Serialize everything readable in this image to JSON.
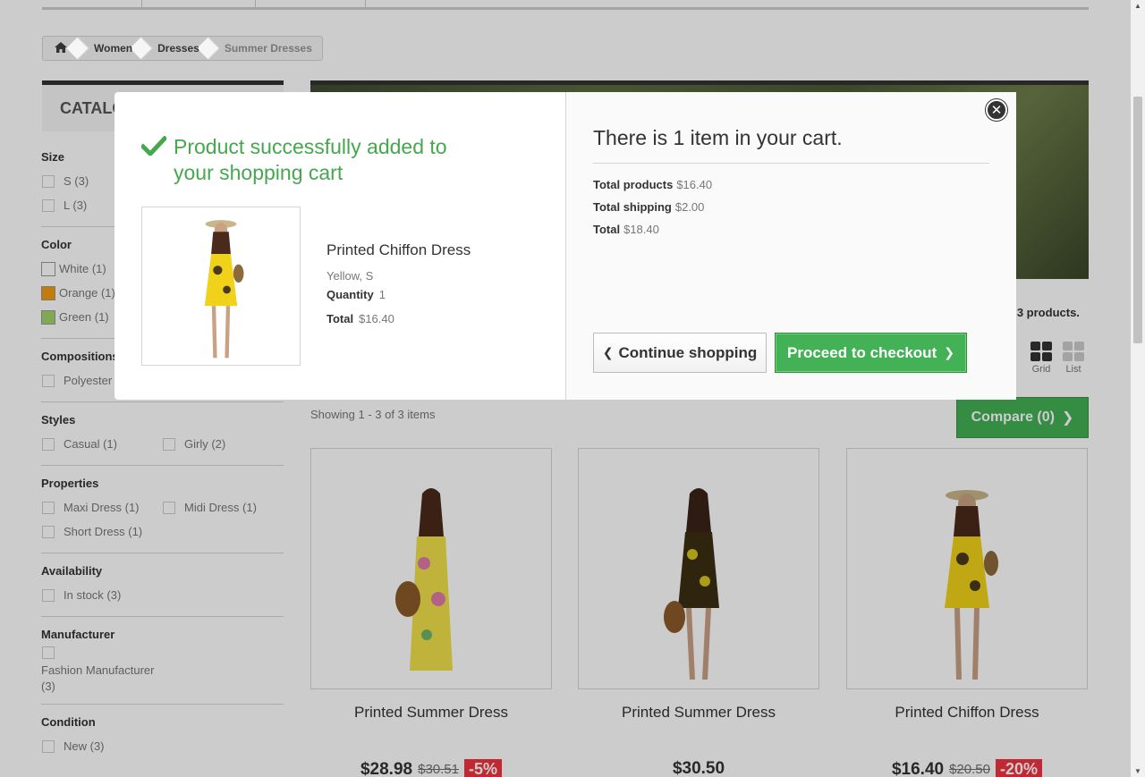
{
  "breadcrumb": {
    "home_icon": "home-icon",
    "items": [
      "Women",
      "Dresses",
      "Summer Dresses"
    ]
  },
  "catalog": {
    "title": "CATALOG"
  },
  "filters": {
    "size": {
      "title": "Size",
      "options": [
        "S (3)",
        "L (3)"
      ]
    },
    "color": {
      "title": "Color",
      "options": [
        {
          "label": "White (1)",
          "color": "#ffffff"
        },
        {
          "label": "Orange (1)",
          "color": "#f39c11"
        },
        {
          "label": "Green (1)",
          "color": "#a0d468"
        }
      ]
    },
    "compositions": {
      "title": "Compositions",
      "options": [
        "Polyester"
      ]
    },
    "styles": {
      "title": "Styles",
      "options": [
        "Casual (1)",
        "Girly (2)"
      ]
    },
    "properties": {
      "title": "Properties",
      "options": [
        "Maxi Dress (1)",
        "Midi Dress (1)",
        "Short Dress (1)"
      ]
    },
    "availability": {
      "title": "Availability",
      "options": [
        "In stock (3)"
      ]
    },
    "manufacturer": {
      "title": "Manufacturer",
      "options": [
        "Fashion Manufacturer (3)"
      ]
    },
    "condition": {
      "title": "Condition",
      "options": [
        "New (3)"
      ]
    }
  },
  "listing": {
    "products_count": "e 3 products.",
    "view_grid": "Grid",
    "view_list": "List",
    "showing": "Showing 1 - 3 of 3 items",
    "compare_label": "Compare (0)"
  },
  "products": [
    {
      "name": "Printed Summer Dress",
      "price": "$28.98",
      "old_price": "$30.51",
      "discount": "-5%"
    },
    {
      "name": "Printed Summer Dress",
      "price": "$30.50",
      "old_price": "",
      "discount": ""
    },
    {
      "name": "Printed Chiffon Dress",
      "price": "$16.40",
      "old_price": "$20.50",
      "discount": "-20%"
    }
  ],
  "modal": {
    "success_message": "Product successfully added to your shopping cart",
    "product": {
      "name": "Printed Chiffon Dress",
      "attributes": "Yellow, S",
      "quantity_label": "Quantity",
      "quantity": "1",
      "total_label": "Total",
      "total": "$16.40"
    },
    "cart_title": "There is 1 item in your cart.",
    "summary": {
      "products_label": "Total products",
      "products_value": "$16.40",
      "shipping_label": "Total shipping",
      "shipping_value": "$2.00",
      "total_label": "Total",
      "total_value": "$18.40"
    },
    "continue_label": "Continue shopping",
    "checkout_label": "Proceed to checkout"
  },
  "colors": {
    "accent_green": "#43b155",
    "success_text": "#46a74e",
    "discount_red": "#f13340"
  }
}
